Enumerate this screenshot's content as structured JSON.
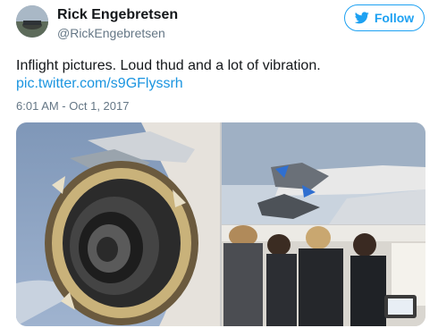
{
  "author": {
    "display_name": "Rick Engebretsen",
    "handle": "@RickEngebretsen"
  },
  "follow_button": {
    "label": "Follow",
    "icon": "twitter-bird-icon"
  },
  "tweet": {
    "text": "Inflight pictures. Loud thud and a lot of vibration.",
    "link": "pic.twitter.com/s9GFlyssrh",
    "timestamp": "6:01 AM - Oct 1, 2017"
  },
  "media": {
    "photos": [
      "damaged-engine-closeup",
      "damaged-engine-wing-view",
      "passengers-looking-out-window"
    ]
  },
  "colors": {
    "accent": "#1da1f2",
    "link": "#1b95e0",
    "secondary_text": "#657786"
  }
}
